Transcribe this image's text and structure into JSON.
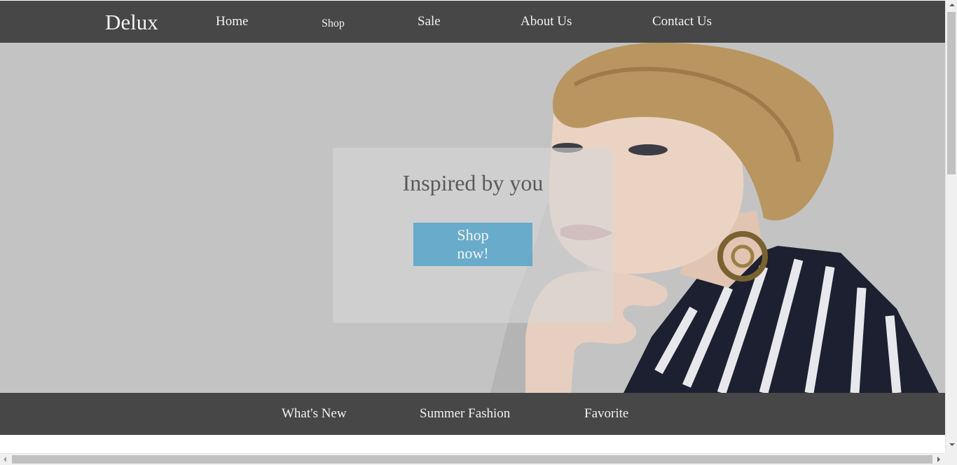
{
  "header": {
    "brand": "Delux",
    "nav": [
      {
        "label": "Home"
      },
      {
        "label": "Shop"
      },
      {
        "label": "Sale"
      },
      {
        "label": "About Us"
      },
      {
        "label": "Contact Us"
      }
    ]
  },
  "hero": {
    "title": "Inspired by you",
    "cta_label": "Shop now!",
    "image": "portrait-of-woman-in-striped-top"
  },
  "subnav": {
    "items": [
      {
        "label": "What's New"
      },
      {
        "label": "Summer Fashion"
      },
      {
        "label": "Favorite"
      }
    ]
  },
  "colors": {
    "nav_bg": "#474747",
    "hero_bg": "#c3c3c3",
    "cta_bg": "#4ba0c8",
    "nav_text": "#f2f2f2"
  }
}
